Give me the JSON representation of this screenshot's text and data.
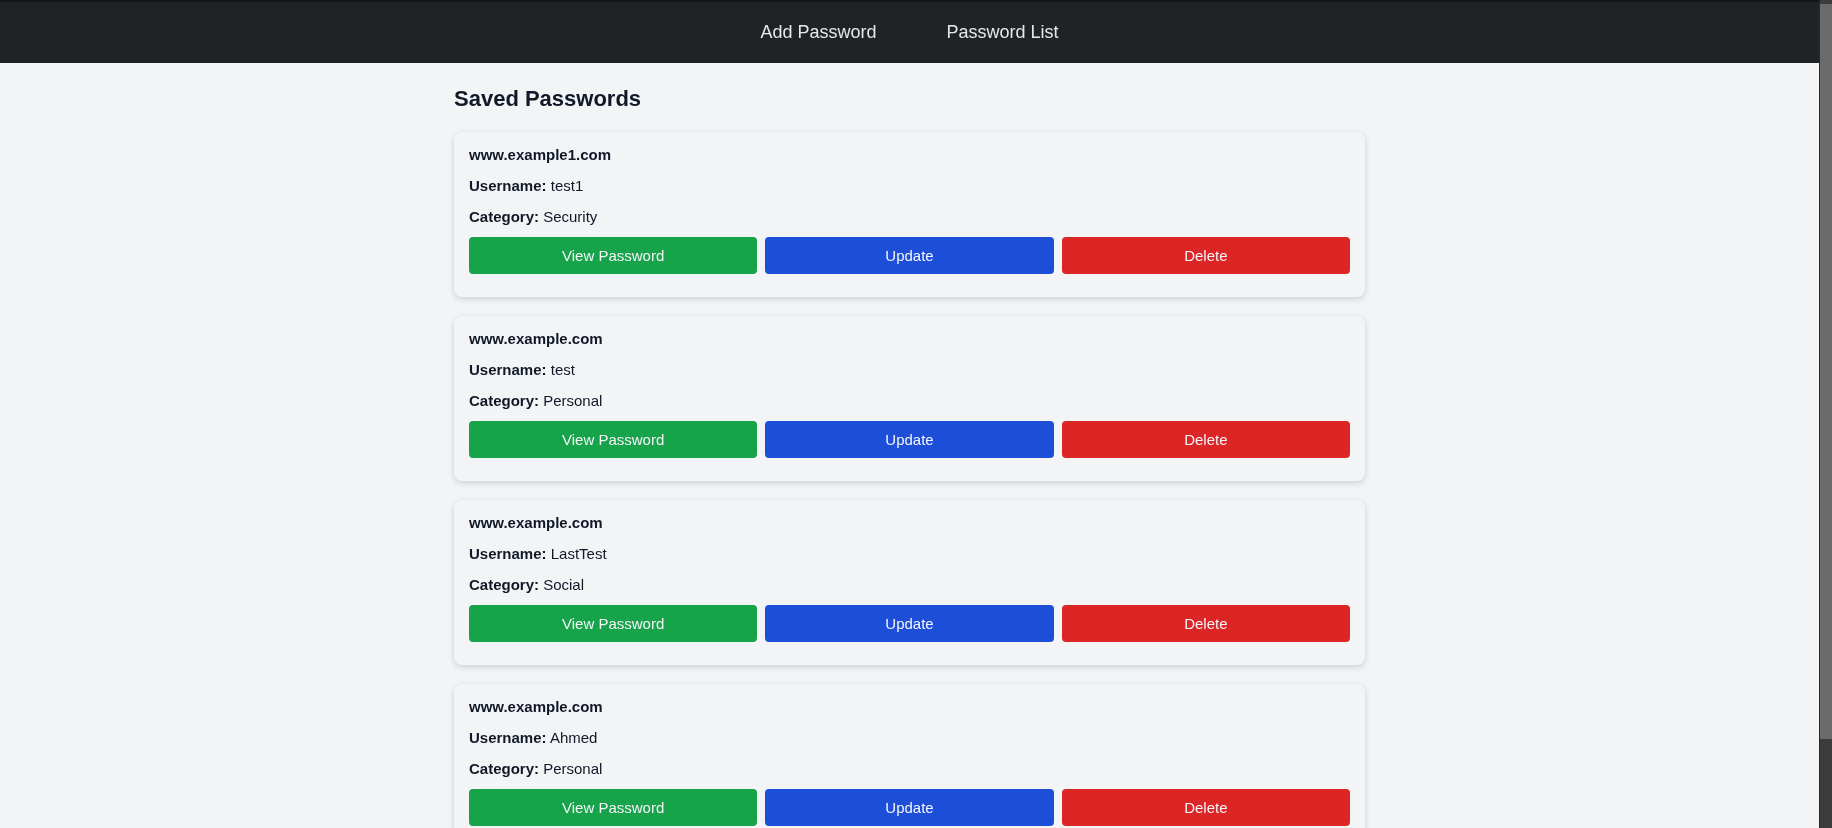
{
  "nav": {
    "links": [
      {
        "label": "Add Password"
      },
      {
        "label": "Password List"
      }
    ]
  },
  "heading": "Saved Passwords",
  "passwords": [
    {
      "site": "www.example1.com",
      "username": "**Username:** test1",
      "category": "**Category:** Security",
      "buttons": [
        {
          "label": "View Password",
          "kind": "view"
        },
        {
          "label": "Update",
          "kind": "update"
        },
        {
          "label": "Delete",
          "kind": "delete"
        }
      ]
    },
    {
      "site": "www.example.com",
      "username": "**Username:** test",
      "category": "**Category:** Personal",
      "buttons": [
        {
          "label": "View Password",
          "kind": "view"
        },
        {
          "label": "Update",
          "kind": "update"
        },
        {
          "label": "Delete",
          "kind": "delete"
        }
      ]
    },
    {
      "site": "www.example.com",
      "username": "**Username:** LastTest",
      "category": "**Category:** Social",
      "buttons": [
        {
          "label": "View Password",
          "kind": "view"
        },
        {
          "label": "Update",
          "kind": "update"
        },
        {
          "label": "Delete",
          "kind": "delete"
        }
      ]
    },
    {
      "site": "www.example.com",
      "username": "**Username:** Ahmed",
      "category": "**Category:** Personal",
      "buttons": [
        {
          "label": "View Password",
          "kind": "view"
        },
        {
          "label": "Update",
          "kind": "update"
        },
        {
          "label": "Delete",
          "kind": "delete"
        }
      ]
    }
  ]
}
